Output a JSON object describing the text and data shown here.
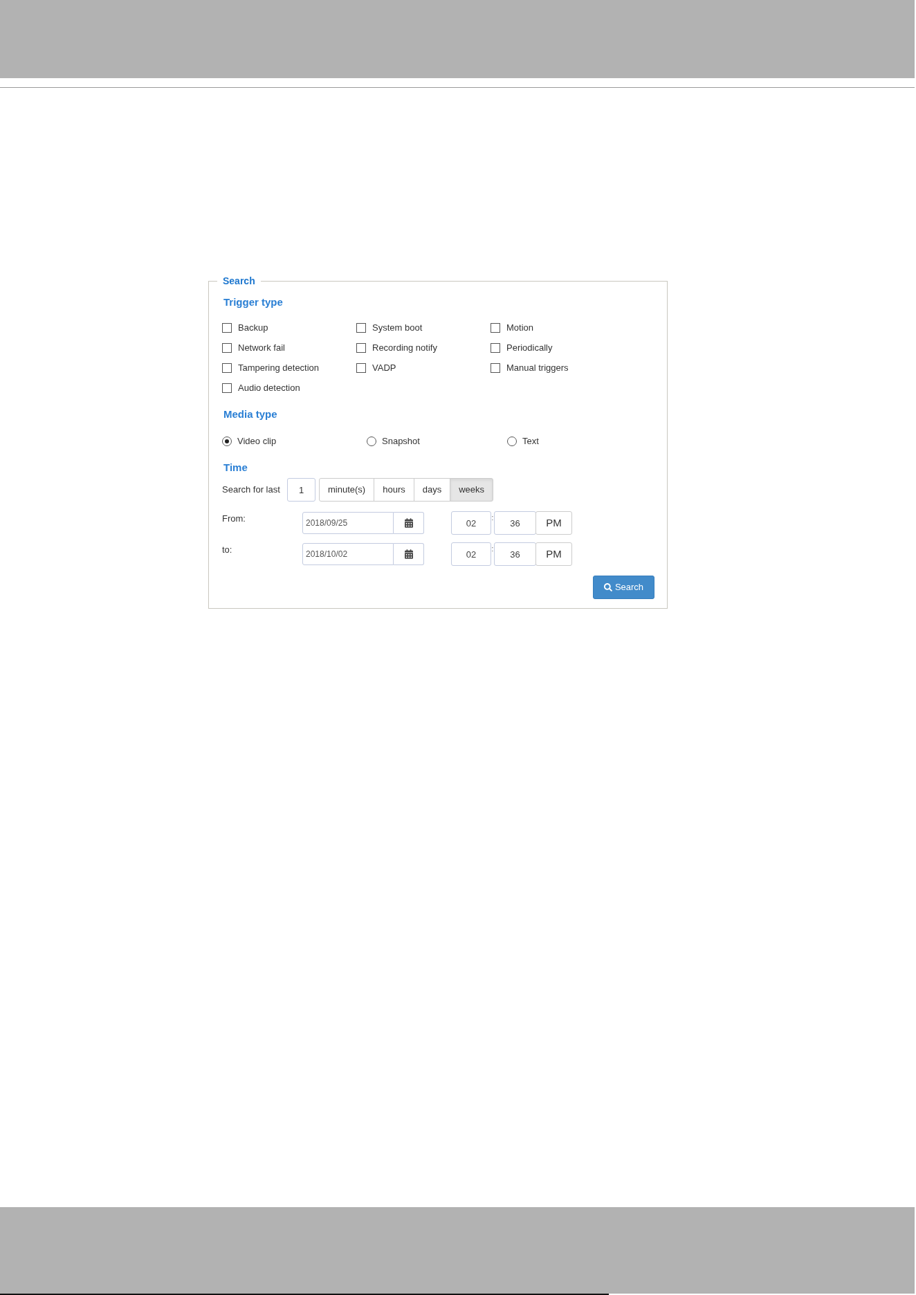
{
  "search_panel": {
    "legend": "Search",
    "trigger_type": {
      "heading": "Trigger type",
      "options": [
        {
          "label": "Backup",
          "checked": false
        },
        {
          "label": "System boot",
          "checked": false
        },
        {
          "label": "Motion",
          "checked": false
        },
        {
          "label": "Network fail",
          "checked": false
        },
        {
          "label": "Recording notify",
          "checked": false
        },
        {
          "label": "Periodically",
          "checked": false
        },
        {
          "label": "Tampering detection",
          "checked": false
        },
        {
          "label": "VADP",
          "checked": false
        },
        {
          "label": "Manual triggers",
          "checked": false
        },
        {
          "label": "Audio detection",
          "checked": false
        }
      ]
    },
    "media_type": {
      "heading": "Media type",
      "options": [
        {
          "label": "Video clip",
          "selected": true
        },
        {
          "label": "Snapshot",
          "selected": false
        },
        {
          "label": "Text",
          "selected": false
        }
      ]
    },
    "time": {
      "heading": "Time",
      "search_for_last": {
        "label": "Search for last",
        "value": "1",
        "units": [
          {
            "label": "minute(s)",
            "selected": false
          },
          {
            "label": "hours",
            "selected": false
          },
          {
            "label": "days",
            "selected": false
          },
          {
            "label": "weeks",
            "selected": true
          }
        ]
      },
      "ranges": [
        {
          "label": "From:",
          "date": "2018/09/25",
          "hour": "02",
          "separator": ":",
          "minute": "36",
          "period": "PM"
        },
        {
          "label": "to:",
          "date": "2018/10/02",
          "hour": "02",
          "separator": ":",
          "minute": "36",
          "period": "PM"
        }
      ]
    },
    "search_button": "Search"
  }
}
